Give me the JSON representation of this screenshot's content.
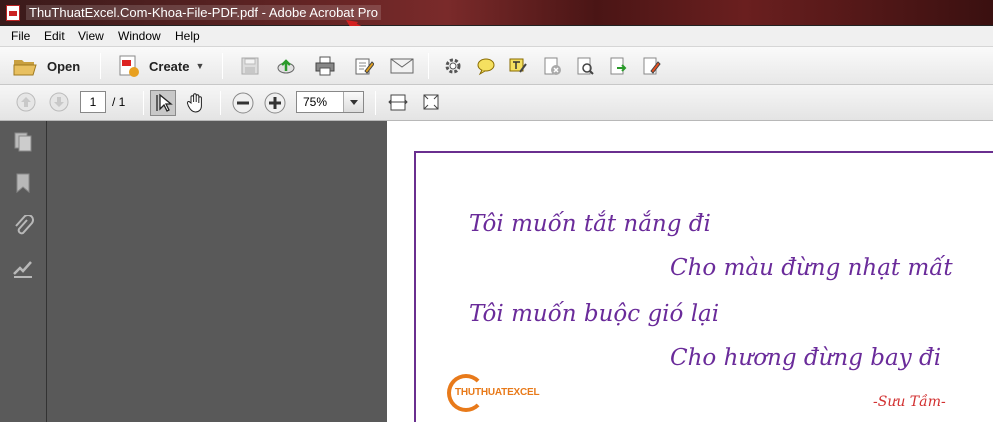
{
  "window": {
    "title": "ThuThuatExcel.Com-Khoa-File-PDF.pdf - Adobe Acrobat Pro"
  },
  "menu": {
    "items": [
      {
        "label": "File"
      },
      {
        "label": "Edit"
      },
      {
        "label": "View"
      },
      {
        "label": "Window"
      },
      {
        "label": "Help"
      }
    ]
  },
  "toolbar": {
    "open_label": "Open",
    "create_label": "Create"
  },
  "navigation": {
    "current_page": "1",
    "page_count": "/ 1",
    "zoom": "75%"
  },
  "document": {
    "lines": [
      "Tôi muốn tắt nắng đi",
      "Cho màu đừng nhạt mất",
      "Tôi muốn buộc gió lại",
      "Cho hương đừng bay đi"
    ],
    "credit": "-Sưu Tầm-",
    "logo_text": "THUTHUATEXCEL"
  },
  "colors": {
    "poem": "#6a2b9a",
    "credit": "#d23030",
    "logo": "#e87a1a",
    "annotation_arrow": "#d42020"
  }
}
